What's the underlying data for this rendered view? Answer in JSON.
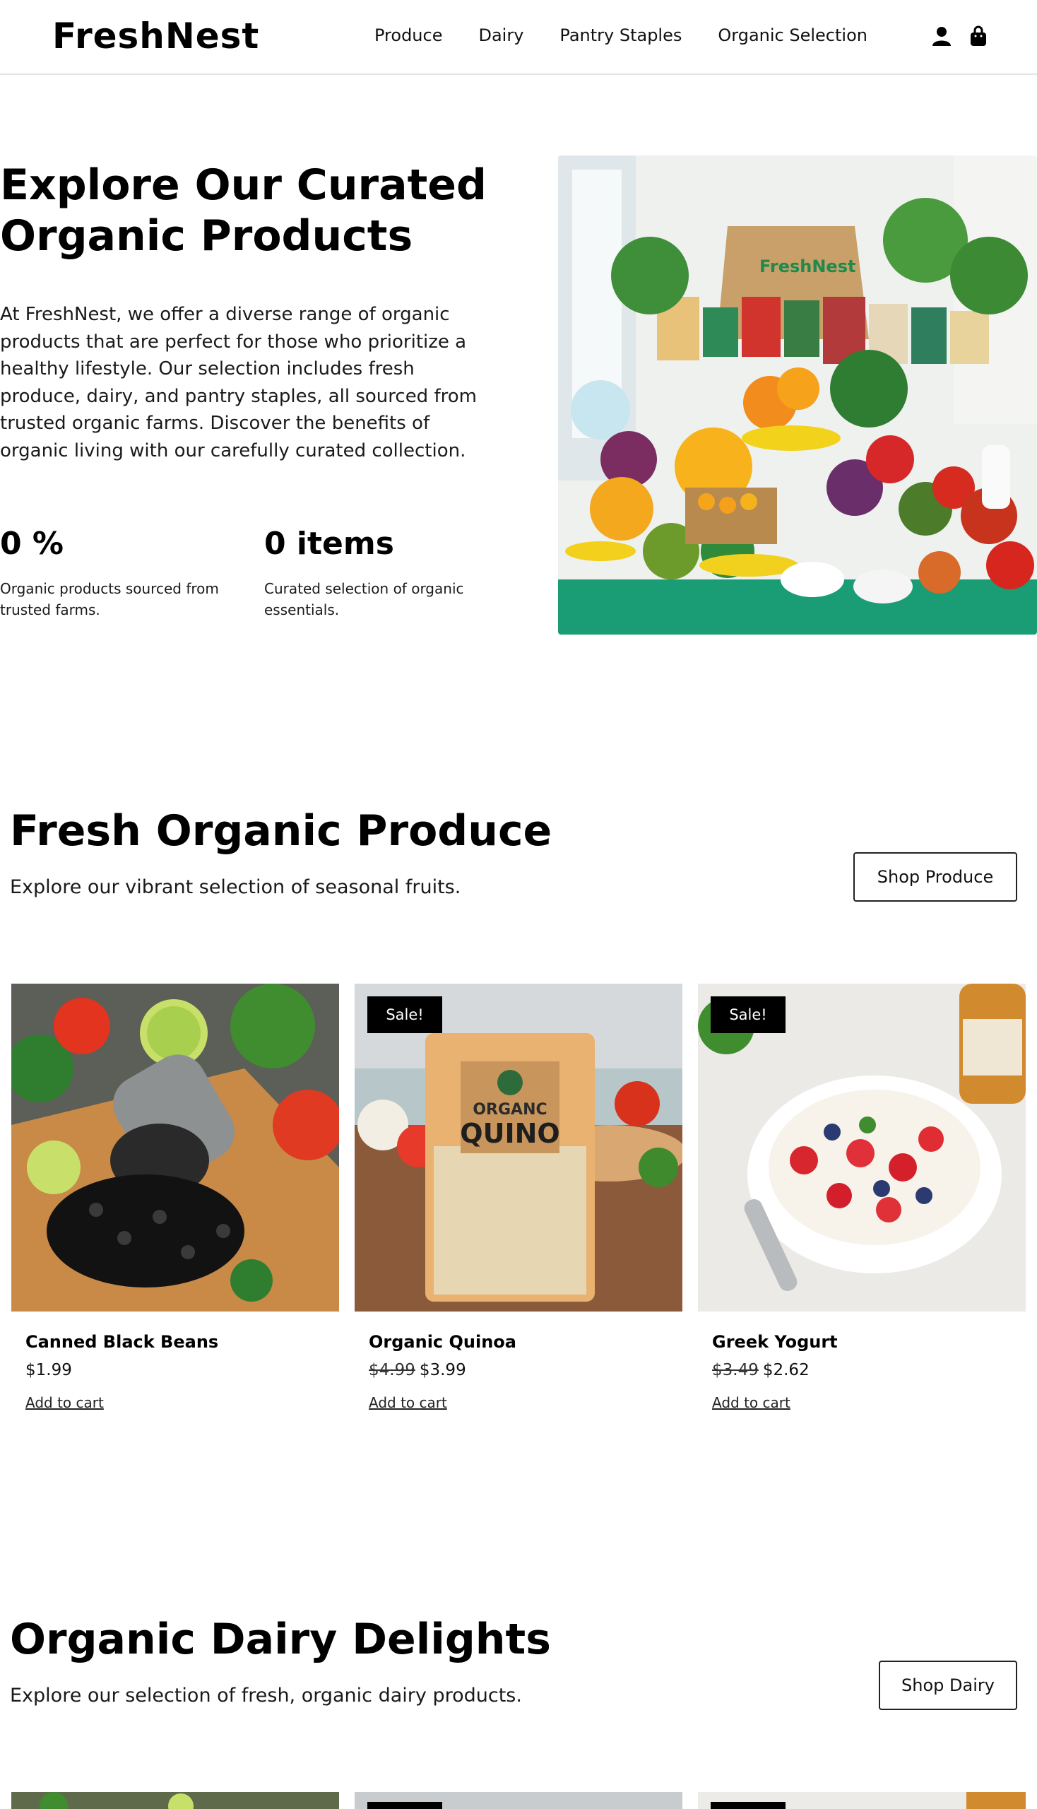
{
  "header": {
    "logo": "FreshNest",
    "nav": [
      "Produce",
      "Dairy",
      "Pantry Staples",
      "Organic Selection"
    ],
    "icons": [
      "user-icon",
      "shopping-bag-icon"
    ]
  },
  "hero": {
    "title_line1": "Explore Our Curated",
    "title_line2": "Organic Products",
    "description": "At FreshNest, we offer a diverse range of organic products that are perfect for those who prioritize a healthy lifestyle. Our selection includes fresh produce, dairy, and pantry staples, all sourced from trusted organic farms. Discover the benefits of organic living with our carefully curated collection.",
    "stats": [
      {
        "value": "0 %",
        "label": "Organic products sourced from trusted farms."
      },
      {
        "value": "0 items",
        "label": "Curated selection of organic essentials."
      }
    ],
    "image_brand": "FreshNest"
  },
  "produce_section": {
    "title": "Fresh Organic Produce",
    "subtitle": "Explore our vibrant selection of seasonal fruits.",
    "button": "Shop Produce"
  },
  "products": [
    {
      "name": "Canned Black Beans",
      "old_price": "",
      "price": "$1.99",
      "sale_badge": "",
      "cart": "Add to cart"
    },
    {
      "name": "Organic Quinoa",
      "old_price": "$4.99",
      "price": "$3.99",
      "sale_badge": "Sale!",
      "cart": "Add to cart",
      "package_text_1": "ORGANC",
      "package_text_2": "QUINO"
    },
    {
      "name": "Greek Yogurt",
      "old_price": "$3.49",
      "price": "$2.62",
      "sale_badge": "Sale!",
      "cart": "Add to cart"
    }
  ],
  "dairy_section": {
    "title": "Organic Dairy Delights",
    "subtitle": "Explore our selection of fresh, organic dairy products.",
    "button": "Shop Dairy"
  },
  "colors": {
    "accent_green": "#1aa37a",
    "text": "#111111",
    "sale_badge": "#000000"
  }
}
